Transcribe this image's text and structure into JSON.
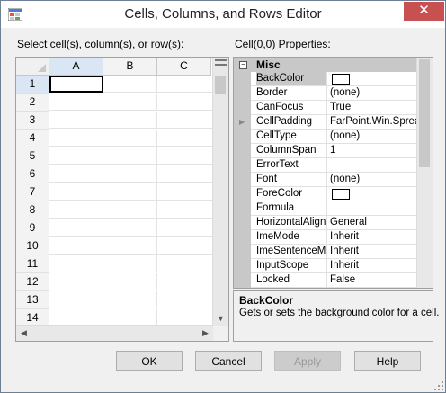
{
  "window": {
    "title": "Cells, Columns, and Rows Editor",
    "close_glyph": "✕"
  },
  "left": {
    "label": "Select cell(s), column(s), or row(s):",
    "columns": [
      "A",
      "B",
      "C"
    ],
    "rows": [
      "1",
      "2",
      "3",
      "4",
      "5",
      "6",
      "7",
      "8",
      "9",
      "10",
      "11",
      "12",
      "13",
      "14"
    ]
  },
  "right": {
    "label": "Cell(0,0) Properties:",
    "category": "Misc",
    "properties": [
      {
        "name": "BackColor",
        "value": "",
        "swatch": true
      },
      {
        "name": "Border",
        "value": "(none)"
      },
      {
        "name": "CanFocus",
        "value": "True"
      },
      {
        "name": "CellPadding",
        "value": "FarPoint.Win.Spread",
        "expand": true
      },
      {
        "name": "CellType",
        "value": "(none)"
      },
      {
        "name": "ColumnSpan",
        "value": "1"
      },
      {
        "name": "ErrorText",
        "value": ""
      },
      {
        "name": "Font",
        "value": "(none)"
      },
      {
        "name": "ForeColor",
        "value": "",
        "swatch": true
      },
      {
        "name": "Formula",
        "value": ""
      },
      {
        "name": "HorizontalAlignm",
        "value": "General"
      },
      {
        "name": "ImeMode",
        "value": "Inherit"
      },
      {
        "name": "ImeSentenceMo",
        "value": "Inherit"
      },
      {
        "name": "InputScope",
        "value": "Inherit"
      },
      {
        "name": "Locked",
        "value": "False"
      }
    ],
    "description": {
      "title": "BackColor",
      "text": "Gets or sets the background color for a cell."
    }
  },
  "buttons": {
    "ok": "OK",
    "cancel": "Cancel",
    "apply": "Apply",
    "help": "Help"
  },
  "colors": {
    "close": "#c75050",
    "selection": "#dbe6f4",
    "category": "#c8c8c8"
  }
}
